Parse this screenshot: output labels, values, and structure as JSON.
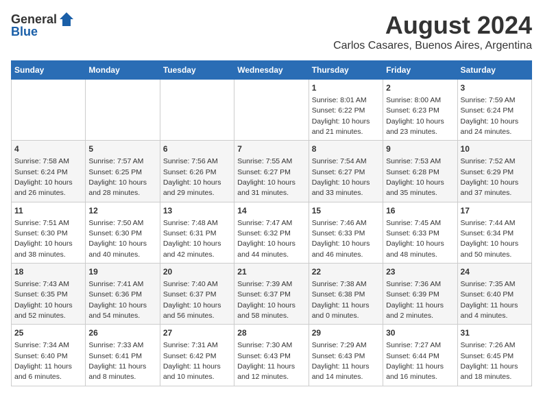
{
  "header": {
    "logo_general": "General",
    "logo_blue": "Blue",
    "main_title": "August 2024",
    "subtitle": "Carlos Casares, Buenos Aires, Argentina"
  },
  "days_of_week": [
    "Sunday",
    "Monday",
    "Tuesday",
    "Wednesday",
    "Thursday",
    "Friday",
    "Saturday"
  ],
  "weeks": [
    [
      {
        "day": "",
        "content": ""
      },
      {
        "day": "",
        "content": ""
      },
      {
        "day": "",
        "content": ""
      },
      {
        "day": "",
        "content": ""
      },
      {
        "day": "1",
        "content": "Sunrise: 8:01 AM\nSunset: 6:22 PM\nDaylight: 10 hours\nand 21 minutes."
      },
      {
        "day": "2",
        "content": "Sunrise: 8:00 AM\nSunset: 6:23 PM\nDaylight: 10 hours\nand 23 minutes."
      },
      {
        "day": "3",
        "content": "Sunrise: 7:59 AM\nSunset: 6:24 PM\nDaylight: 10 hours\nand 24 minutes."
      }
    ],
    [
      {
        "day": "4",
        "content": "Sunrise: 7:58 AM\nSunset: 6:24 PM\nDaylight: 10 hours\nand 26 minutes."
      },
      {
        "day": "5",
        "content": "Sunrise: 7:57 AM\nSunset: 6:25 PM\nDaylight: 10 hours\nand 28 minutes."
      },
      {
        "day": "6",
        "content": "Sunrise: 7:56 AM\nSunset: 6:26 PM\nDaylight: 10 hours\nand 29 minutes."
      },
      {
        "day": "7",
        "content": "Sunrise: 7:55 AM\nSunset: 6:27 PM\nDaylight: 10 hours\nand 31 minutes."
      },
      {
        "day": "8",
        "content": "Sunrise: 7:54 AM\nSunset: 6:27 PM\nDaylight: 10 hours\nand 33 minutes."
      },
      {
        "day": "9",
        "content": "Sunrise: 7:53 AM\nSunset: 6:28 PM\nDaylight: 10 hours\nand 35 minutes."
      },
      {
        "day": "10",
        "content": "Sunrise: 7:52 AM\nSunset: 6:29 PM\nDaylight: 10 hours\nand 37 minutes."
      }
    ],
    [
      {
        "day": "11",
        "content": "Sunrise: 7:51 AM\nSunset: 6:30 PM\nDaylight: 10 hours\nand 38 minutes."
      },
      {
        "day": "12",
        "content": "Sunrise: 7:50 AM\nSunset: 6:30 PM\nDaylight: 10 hours\nand 40 minutes."
      },
      {
        "day": "13",
        "content": "Sunrise: 7:48 AM\nSunset: 6:31 PM\nDaylight: 10 hours\nand 42 minutes."
      },
      {
        "day": "14",
        "content": "Sunrise: 7:47 AM\nSunset: 6:32 PM\nDaylight: 10 hours\nand 44 minutes."
      },
      {
        "day": "15",
        "content": "Sunrise: 7:46 AM\nSunset: 6:33 PM\nDaylight: 10 hours\nand 46 minutes."
      },
      {
        "day": "16",
        "content": "Sunrise: 7:45 AM\nSunset: 6:33 PM\nDaylight: 10 hours\nand 48 minutes."
      },
      {
        "day": "17",
        "content": "Sunrise: 7:44 AM\nSunset: 6:34 PM\nDaylight: 10 hours\nand 50 minutes."
      }
    ],
    [
      {
        "day": "18",
        "content": "Sunrise: 7:43 AM\nSunset: 6:35 PM\nDaylight: 10 hours\nand 52 minutes."
      },
      {
        "day": "19",
        "content": "Sunrise: 7:41 AM\nSunset: 6:36 PM\nDaylight: 10 hours\nand 54 minutes."
      },
      {
        "day": "20",
        "content": "Sunrise: 7:40 AM\nSunset: 6:37 PM\nDaylight: 10 hours\nand 56 minutes."
      },
      {
        "day": "21",
        "content": "Sunrise: 7:39 AM\nSunset: 6:37 PM\nDaylight: 10 hours\nand 58 minutes."
      },
      {
        "day": "22",
        "content": "Sunrise: 7:38 AM\nSunset: 6:38 PM\nDaylight: 11 hours\nand 0 minutes."
      },
      {
        "day": "23",
        "content": "Sunrise: 7:36 AM\nSunset: 6:39 PM\nDaylight: 11 hours\nand 2 minutes."
      },
      {
        "day": "24",
        "content": "Sunrise: 7:35 AM\nSunset: 6:40 PM\nDaylight: 11 hours\nand 4 minutes."
      }
    ],
    [
      {
        "day": "25",
        "content": "Sunrise: 7:34 AM\nSunset: 6:40 PM\nDaylight: 11 hours\nand 6 minutes."
      },
      {
        "day": "26",
        "content": "Sunrise: 7:33 AM\nSunset: 6:41 PM\nDaylight: 11 hours\nand 8 minutes."
      },
      {
        "day": "27",
        "content": "Sunrise: 7:31 AM\nSunset: 6:42 PM\nDaylight: 11 hours\nand 10 minutes."
      },
      {
        "day": "28",
        "content": "Sunrise: 7:30 AM\nSunset: 6:43 PM\nDaylight: 11 hours\nand 12 minutes."
      },
      {
        "day": "29",
        "content": "Sunrise: 7:29 AM\nSunset: 6:43 PM\nDaylight: 11 hours\nand 14 minutes."
      },
      {
        "day": "30",
        "content": "Sunrise: 7:27 AM\nSunset: 6:44 PM\nDaylight: 11 hours\nand 16 minutes."
      },
      {
        "day": "31",
        "content": "Sunrise: 7:26 AM\nSunset: 6:45 PM\nDaylight: 11 hours\nand 18 minutes."
      }
    ]
  ]
}
